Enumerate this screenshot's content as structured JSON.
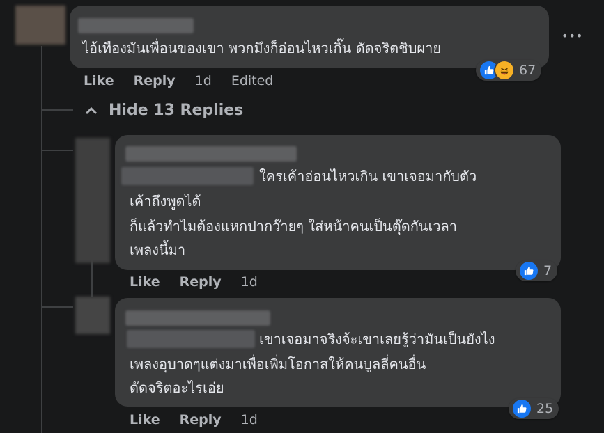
{
  "comment": {
    "text": "ไอ้เทืองมันเพื่อนของเขา พวกมึงก็อ่อนไหวเกิ๊น ดัดจริตชิบผาย",
    "actions": {
      "like": "Like",
      "reply": "Reply",
      "time": "1d",
      "edited": "Edited"
    },
    "reactions": {
      "count": "67",
      "icons": [
        "like-icon",
        "haha-icon"
      ]
    },
    "more": "•••"
  },
  "replies_toggle": {
    "label": "Hide 13 Replies"
  },
  "replies": [
    {
      "lines": [
        "ใครเค้าอ่อนไหวเกิน เขาเจอมากับตัว",
        "เค้าถึงพูดได้",
        "ก็แล้วทำไมต้องแหกปากว๊ายๆ ใส่หน้าคนเป็นตุ๊ดกันเวลา",
        "เพลงนี้มา"
      ],
      "actions": {
        "like": "Like",
        "reply": "Reply",
        "time": "1d"
      },
      "reactions": {
        "count": "7",
        "icons": [
          "like-icon"
        ]
      }
    },
    {
      "lines": [
        "เขาเจอมาจริงจ้ะเขาเลยรู้ว่ามันเป็นยังไง",
        "เพลงอุบาดๆแต่งมาเพื่อเพิ่มโอกาสให้คนบูลลี่คนอื่น",
        "ดัดจริตอะไรเอ่ย"
      ],
      "actions": {
        "like": "Like",
        "reply": "Reply",
        "time": "1d"
      },
      "reactions": {
        "count": "25",
        "icons": [
          "like-icon"
        ]
      }
    }
  ]
}
